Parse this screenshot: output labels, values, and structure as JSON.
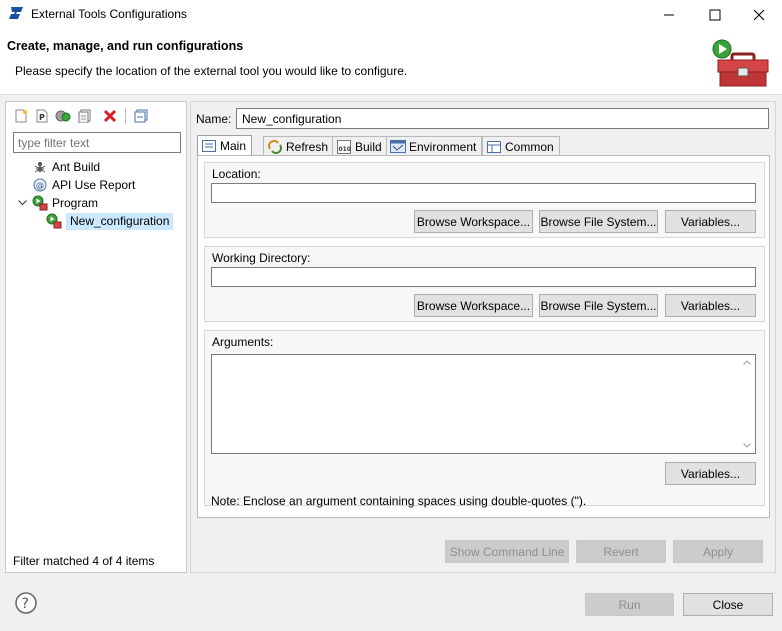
{
  "window": {
    "title": "External Tools Configurations",
    "icons": {
      "app": "st-logo-icon",
      "minimize": "minimize-icon",
      "maximize": "maximize-icon",
      "close": "close-icon"
    }
  },
  "header": {
    "title": "Create, manage, and run configurations",
    "description": "Please specify the location of the external tool you would like to configure.",
    "banner_icon": "toolbox-run-icon"
  },
  "left": {
    "toolbar": [
      "new-configuration-icon",
      "new-prototype-icon",
      "duplicate-icon",
      "export-icon",
      "delete-icon",
      "collapse-all-icon"
    ],
    "filter_placeholder": "type filter text",
    "tree": [
      {
        "label": "Ant Build",
        "icon": "ant-icon",
        "level": 0
      },
      {
        "label": "API Use Report",
        "icon": "api-report-icon",
        "level": 0
      },
      {
        "label": "Program",
        "icon": "program-icon",
        "level": 0,
        "expanded": true
      },
      {
        "label": "New_configuration",
        "icon": "program-config-icon",
        "level": 1,
        "selected": true
      }
    ],
    "status": "Filter matched 4 of 4 items"
  },
  "right": {
    "name_label": "Name:",
    "name_value": "New_configuration",
    "tabs": [
      {
        "label": "Main",
        "icon": "main-tab-icon",
        "active": true
      },
      {
        "label": "Refresh",
        "icon": "refresh-icon"
      },
      {
        "label": "Build",
        "icon": "build-icon"
      },
      {
        "label": "Environment",
        "icon": "environment-icon"
      },
      {
        "label": "Common",
        "icon": "common-icon"
      }
    ],
    "location": {
      "label": "Location:",
      "value": "",
      "browse_workspace": "Browse Workspace...",
      "browse_fs": "Browse File System...",
      "variables": "Variables..."
    },
    "working_dir": {
      "label": "Working Directory:",
      "value": "",
      "browse_workspace": "Browse Workspace...",
      "browse_fs": "Browse File System...",
      "variables": "Variables..."
    },
    "arguments": {
      "label": "Arguments:",
      "value": "",
      "variables": "Variables...",
      "note": "Note: Enclose an argument containing spaces using double-quotes (\")."
    },
    "buttons": {
      "show_command_line": "Show Command Line",
      "revert": "Revert",
      "apply": "Apply"
    }
  },
  "footer": {
    "help_icon": "help-icon",
    "run": "Run",
    "close": "Close"
  }
}
